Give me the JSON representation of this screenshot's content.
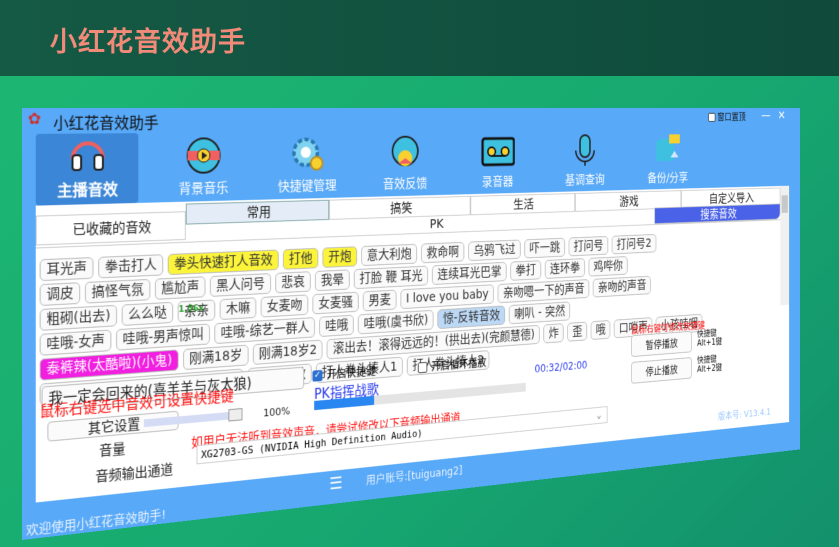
{
  "page_title": "小红花音效助手",
  "window": {
    "title": "小红花音效助手",
    "pin_label": "窗口置顶",
    "pin_checked": false,
    "minimize": "—",
    "close": "✕"
  },
  "toolbar": [
    {
      "label": "主播音效",
      "icon": "headphones-icon"
    },
    {
      "label": "背景音乐",
      "icon": "music-disc-icon"
    },
    {
      "label": "快捷键管理",
      "icon": "gear-icon"
    },
    {
      "label": "音效反馈",
      "icon": "feedback-icon"
    },
    {
      "label": "录音器",
      "icon": "cassette-icon"
    },
    {
      "label": "基调查询",
      "icon": "microphone-icon"
    },
    {
      "label": "备份/分享",
      "icon": "database-icon"
    }
  ],
  "tabs": {
    "row1": [
      "已收藏的音效",
      "常用",
      "搞笑",
      "生活",
      "游戏",
      "自定义导入"
    ],
    "row2": [
      "PK",
      "搜索音效"
    ],
    "selected": "常用"
  },
  "sounds": [
    [
      {
        "t": "耳光声"
      },
      {
        "t": "拳击打人"
      },
      {
        "t": "拳头快速打人音效",
        "c": "y"
      },
      {
        "t": "打他",
        "c": "y"
      },
      {
        "t": "开炮",
        "c": "y"
      },
      {
        "t": "意大利炮"
      },
      {
        "t": "救命啊"
      },
      {
        "t": "乌鸦飞过"
      },
      {
        "t": "吓一跳"
      },
      {
        "t": "打问号"
      },
      {
        "t": "打问号2"
      }
    ],
    [
      {
        "t": "调皮"
      },
      {
        "t": "搞怪气氛"
      },
      {
        "t": "尴尬声"
      },
      {
        "t": "黑人问号"
      },
      {
        "t": "悲哀"
      },
      {
        "t": "我晕"
      },
      {
        "t": "打脸 鞭 耳光"
      },
      {
        "t": "连续耳光巴掌"
      },
      {
        "t": "拳打"
      },
      {
        "t": "连环拳"
      },
      {
        "t": "鸡哔你"
      }
    ],
    [
      {
        "t": "粗砌(出去)"
      },
      {
        "t": "么么哒"
      },
      {
        "t": "亲亲"
      },
      {
        "t": "木嘛"
      },
      {
        "t": "女麦吻"
      },
      {
        "t": "女麦骚"
      },
      {
        "t": "男麦"
      },
      {
        "t": "I love you baby"
      },
      {
        "t": "亲吻嗯一下的声音"
      },
      {
        "t": "亲吻的声音"
      }
    ],
    [
      {
        "t": "哇哦-女声"
      },
      {
        "t": "哇哦-男声惊叫"
      },
      {
        "t": "哇哦-综艺一群人"
      },
      {
        "t": "哇哦"
      },
      {
        "t": "哇哦(虞书欣)"
      },
      {
        "t": "惊-反转音效",
        "c": "b"
      },
      {
        "t": "喇叭 - 突然"
      }
    ],
    [
      {
        "t": "泰裤辣(太酷啦)(小鬼)",
        "c": "m"
      },
      {
        "t": "刚满18岁"
      },
      {
        "t": "刚满18岁2"
      },
      {
        "t": "滚出去！滚得远远的！(拱出去)(完颜慧德)"
      },
      {
        "t": "炸"
      },
      {
        "t": "歪"
      },
      {
        "t": "哦"
      },
      {
        "t": "口哨声"
      },
      {
        "t": "小孩哇咽"
      }
    ],
    [
      {
        "t": "我一定会回来的(喜羊羊与灰太狼)"
      },
      {
        "t": "文松-刺激"
      },
      {
        "t": "打人拳头揍人1"
      },
      {
        "t": "打人拳头揍人2"
      }
    ]
  ],
  "speed_badge": "1.56x",
  "now_playing": "我一定会回来的(喜羊羊与灰太狼)",
  "controls": {
    "hint_set_hotkey": "鼠标右键选中音效可设置快捷键",
    "other_settings": "其它设置",
    "volume_label": "音量",
    "volume_value": "100%",
    "volume_percent": 100,
    "hotkey_enable_label": "开启快捷键",
    "hotkey_enable_checked": true,
    "loop_label": "开启循环播放",
    "loop_checked": false,
    "track_name": "PK指挥战歌",
    "progress_fraction": 0.27,
    "time": "00:32/02:00",
    "audio_hint": "如用户无法听到音效声音，请尝试修改以下音频输出通道",
    "output_label": "音频输出通道",
    "output_value": "XG2703-GS (NVIDIA High Definition Audio)",
    "hint_modify_hotkey": "鼠标右键可修改快捷键",
    "pause_label": "暂停播放",
    "pause_hotkey": "快捷键",
    "pause_combo": "Alt+1键",
    "stop_label": "停止播放",
    "stop_hotkey": "快捷键",
    "stop_combo": "Alt+2键",
    "version": "版本号: V13.4.1"
  },
  "status": {
    "welcome": "欢迎使用小红花音效助手!",
    "account": "用户账号:[tuiguang2]"
  },
  "colors": {
    "window": "#58a9f8",
    "accent": "#4a62e8",
    "yellow": "#fbf43a",
    "magenta": "#f11fe0",
    "hint": "#f11111",
    "track": "#2a3bf0"
  }
}
